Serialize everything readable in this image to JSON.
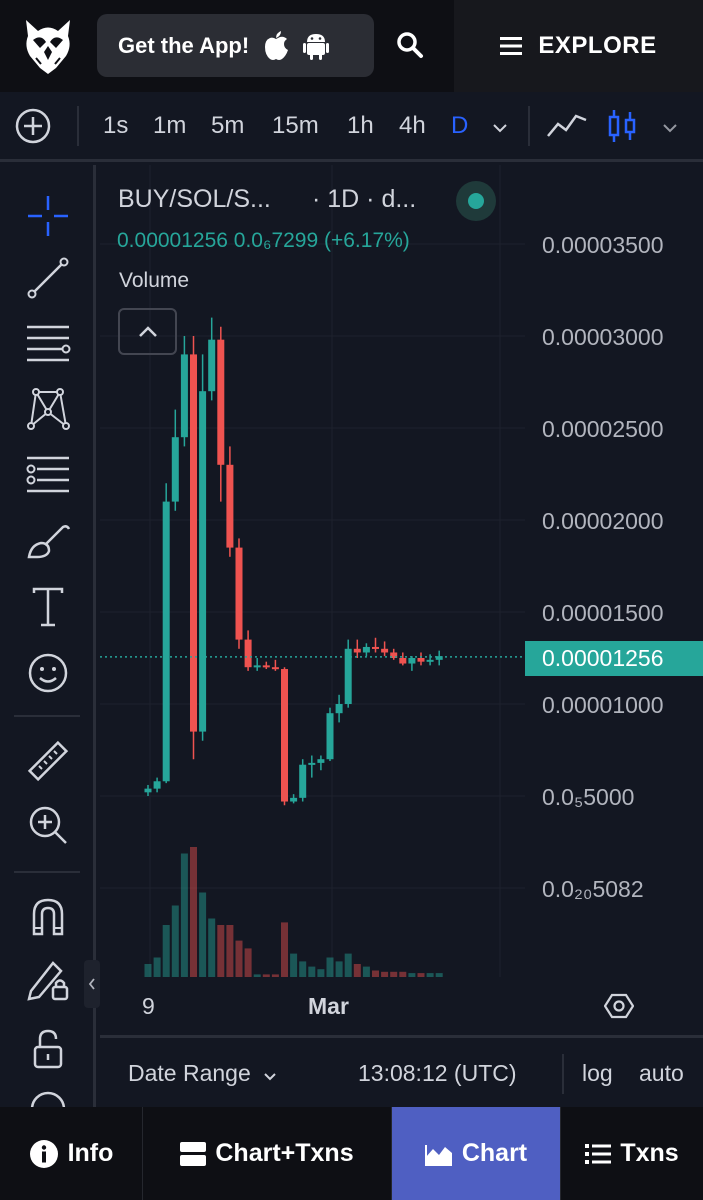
{
  "header": {
    "get_app_label": "Get the App!",
    "explore_label": "EXPLORE"
  },
  "toolbar": {
    "timeframes": [
      "1s",
      "1m",
      "5m",
      "15m",
      "1h",
      "4h",
      "D"
    ],
    "active_timeframe": "D"
  },
  "legend": {
    "title": "BUY/SOL/S...",
    "interval": "· 1D · d...",
    "values": "0.00001256  0.0₆7299 (+6.17%)",
    "volume_label": "Volume"
  },
  "price_axis": {
    "labels": [
      "0.00003500",
      "0.00003000",
      "0.00002500",
      "0.00002000",
      "0.00001500",
      "0.00001000",
      "0.0₅5000",
      "0.0₂₀5082"
    ],
    "current": "0.00001256"
  },
  "time_axis": {
    "labels": [
      "9",
      "Mar"
    ]
  },
  "bottom_bar": {
    "date_range": "Date Range",
    "clock": "13:08:12 (UTC)",
    "log": "log",
    "auto": "auto"
  },
  "nav": {
    "info": "Info",
    "chart_txns": "Chart+Txns",
    "chart": "Chart",
    "txns": "Txns"
  },
  "colors": {
    "up": "#26a69a",
    "down": "#ef5350",
    "accent": "#2962ff",
    "nav_active": "#4f5fc2"
  },
  "chart_data": {
    "type": "candlestick",
    "pair": "BUY/SOL/S...",
    "interval": "1D",
    "x_labels": [
      "9",
      "Mar"
    ],
    "y_unit": "price",
    "ylim": [
      5.082e-06,
      3.5e-05
    ],
    "grid": true,
    "current_price": 1.256e-05,
    "candles": [
      {
        "o": 5.2e-06,
        "h": 5.6e-06,
        "l": 5e-06,
        "c": 5.4e-06,
        "v": 0.1
      },
      {
        "o": 5.4e-06,
        "h": 6e-06,
        "l": 5.2e-06,
        "c": 5.8e-06,
        "v": 0.15
      },
      {
        "o": 5.8e-06,
        "h": 2.2e-05,
        "l": 5.7e-06,
        "c": 2.1e-05,
        "v": 0.4
      },
      {
        "o": 2.1e-05,
        "h": 2.6e-05,
        "l": 2.05e-05,
        "c": 2.45e-05,
        "v": 0.55
      },
      {
        "o": 2.45e-05,
        "h": 3e-05,
        "l": 2.4e-05,
        "c": 2.9e-05,
        "v": 0.95
      },
      {
        "o": 2.9e-05,
        "h": 3e-05,
        "l": 7e-06,
        "c": 8.5e-06,
        "v": 1.0
      },
      {
        "o": 8.5e-06,
        "h": 2.9e-05,
        "l": 8e-06,
        "c": 2.7e-05,
        "v": 0.65
      },
      {
        "o": 2.7e-05,
        "h": 3.1e-05,
        "l": 2.65e-05,
        "c": 2.98e-05,
        "v": 0.45
      },
      {
        "o": 2.98e-05,
        "h": 3.05e-05,
        "l": 2.1e-05,
        "c": 2.3e-05,
        "v": 0.4
      },
      {
        "o": 2.3e-05,
        "h": 2.4e-05,
        "l": 1.8e-05,
        "c": 1.85e-05,
        "v": 0.4
      },
      {
        "o": 1.85e-05,
        "h": 1.9e-05,
        "l": 1.3e-05,
        "c": 1.35e-05,
        "v": 0.28
      },
      {
        "o": 1.35e-05,
        "h": 1.4e-05,
        "l": 1.18e-05,
        "c": 1.2e-05,
        "v": 0.22
      },
      {
        "o": 1.2e-05,
        "h": 1.25e-05,
        "l": 1.18e-05,
        "c": 1.21e-05,
        "v": 0.02
      },
      {
        "o": 1.21e-05,
        "h": 1.23e-05,
        "l": 1.19e-05,
        "c": 1.2e-05,
        "v": 0.02
      },
      {
        "o": 1.2e-05,
        "h": 1.24e-05,
        "l": 1.18e-05,
        "c": 1.19e-05,
        "v": 0.02
      },
      {
        "o": 1.19e-05,
        "h": 1.2e-05,
        "l": 4.5e-06,
        "c": 4.7e-06,
        "v": 0.42
      },
      {
        "o": 4.7e-06,
        "h": 5.1e-06,
        "l": 4.6e-06,
        "c": 4.9e-06,
        "v": 0.18
      },
      {
        "o": 4.9e-06,
        "h": 7e-06,
        "l": 4.7e-06,
        "c": 6.7e-06,
        "v": 0.12
      },
      {
        "o": 6.7e-06,
        "h": 7.2e-06,
        "l": 6e-06,
        "c": 6.8e-06,
        "v": 0.08
      },
      {
        "o": 6.8e-06,
        "h": 7.2e-06,
        "l": 6.4e-06,
        "c": 7e-06,
        "v": 0.06
      },
      {
        "o": 7e-06,
        "h": 9.8e-06,
        "l": 6.9e-06,
        "c": 9.5e-06,
        "v": 0.15
      },
      {
        "o": 9.5e-06,
        "h": 1.05e-05,
        "l": 9e-06,
        "c": 1e-05,
        "v": 0.12
      },
      {
        "o": 1e-05,
        "h": 1.35e-05,
        "l": 9.8e-06,
        "c": 1.3e-05,
        "v": 0.18
      },
      {
        "o": 1.3e-05,
        "h": 1.35e-05,
        "l": 1.25e-05,
        "c": 1.28e-05,
        "v": 0.1
      },
      {
        "o": 1.28e-05,
        "h": 1.33e-05,
        "l": 1.26e-05,
        "c": 1.31e-05,
        "v": 0.08
      },
      {
        "o": 1.31e-05,
        "h": 1.36e-05,
        "l": 1.28e-05,
        "c": 1.3e-05,
        "v": 0.05
      },
      {
        "o": 1.3e-05,
        "h": 1.34e-05,
        "l": 1.26e-05,
        "c": 1.28e-05,
        "v": 0.04
      },
      {
        "o": 1.28e-05,
        "h": 1.3e-05,
        "l": 1.24e-05,
        "c": 1.25e-05,
        "v": 0.04
      },
      {
        "o": 1.25e-05,
        "h": 1.28e-05,
        "l": 1.21e-05,
        "c": 1.22e-05,
        "v": 0.04
      },
      {
        "o": 1.22e-05,
        "h": 1.26e-05,
        "l": 1.18e-05,
        "c": 1.25e-05,
        "v": 0.03
      },
      {
        "o": 1.25e-05,
        "h": 1.28e-05,
        "l": 1.21e-05,
        "c": 1.23e-05,
        "v": 0.03
      },
      {
        "o": 1.23e-05,
        "h": 1.27e-05,
        "l": 1.21e-05,
        "c": 1.24e-05,
        "v": 0.03
      },
      {
        "o": 1.24e-05,
        "h": 1.29e-05,
        "l": 1.21e-05,
        "c": 1.26e-05,
        "v": 0.03
      }
    ]
  }
}
